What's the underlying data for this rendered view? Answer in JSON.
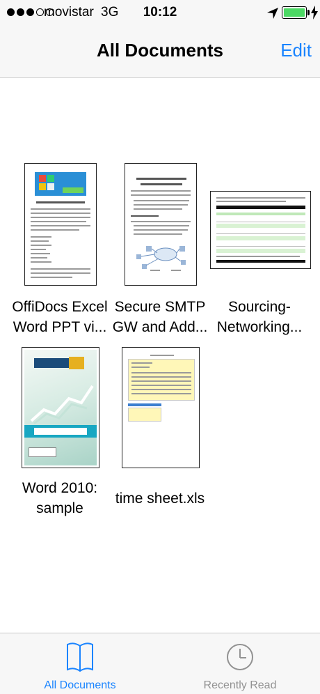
{
  "status": {
    "carrier": "movistar",
    "network": "3G",
    "time": "10:12"
  },
  "nav": {
    "title": "All Documents",
    "edit_label": "Edit"
  },
  "documents": [
    {
      "line1": "OffiDocs Excel",
      "line2": "Word PPT vi..."
    },
    {
      "line1": "Secure SMTP",
      "line2": "GW and Add..."
    },
    {
      "line1": "Sourcing-",
      "line2": "Networking..."
    },
    {
      "line1": "Word 2010:",
      "line2": "sample"
    },
    {
      "line1": "time sheet.xls",
      "line2": ""
    }
  ],
  "tabs": [
    {
      "label": "All Documents",
      "icon": "book-icon",
      "active": true
    },
    {
      "label": "Recently Read",
      "icon": "clock-icon",
      "active": false
    }
  ],
  "colors": {
    "accent": "#1a84ff",
    "battery": "#4cd964",
    "inactive": "#929292"
  }
}
